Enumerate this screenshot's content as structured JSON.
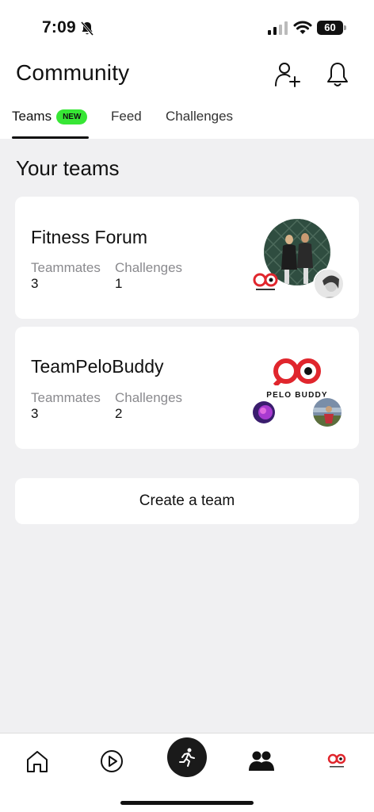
{
  "status_bar": {
    "time": "7:09",
    "battery": "60",
    "icons": [
      "bell-slash-icon",
      "signal-icon",
      "wifi-icon",
      "battery-icon"
    ]
  },
  "header": {
    "title": "Community",
    "icons": [
      "add-friend-icon",
      "bell-icon"
    ]
  },
  "tabs": [
    {
      "label": "Teams",
      "badge": "NEW",
      "active": true
    },
    {
      "label": "Feed",
      "active": false
    },
    {
      "label": "Challenges",
      "active": false
    }
  ],
  "section": {
    "title": "Your teams"
  },
  "teams": [
    {
      "name": "Fitness Forum",
      "teammates_label": "Teammates",
      "teammates": "3",
      "challenges_label": "Challenges",
      "challenges": "1"
    },
    {
      "name": "TeamPeloBuddy",
      "teammates_label": "Teammates",
      "teammates": "3",
      "challenges_label": "Challenges",
      "challenges": "2",
      "logo_text": "PELO BUDDY"
    }
  ],
  "create_team_label": "Create a team",
  "bottom_nav": [
    "home-icon",
    "play-icon",
    "run-icon",
    "friends-icon",
    "profile-avatar"
  ],
  "colors": {
    "badge_green": "#37e635",
    "background": "#f0f0f2",
    "brand_red": "#e0262d",
    "dark": "#1a1a1a"
  }
}
